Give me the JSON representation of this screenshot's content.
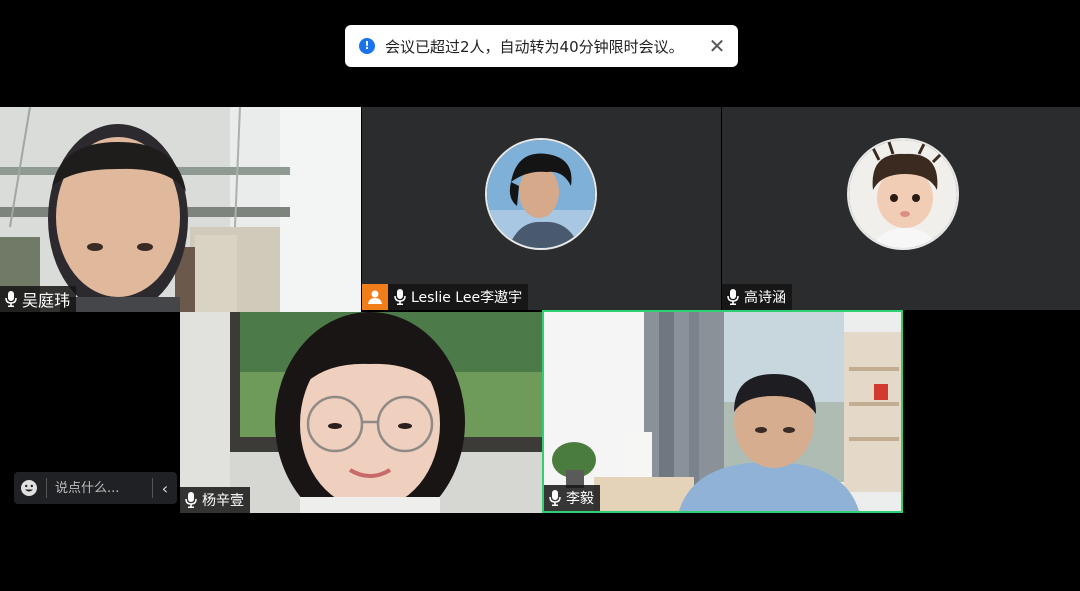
{
  "toast": {
    "icon": "info-icon",
    "icon_glyph": "!",
    "message": "会议已超过2人，自动转为40分钟限时会议。",
    "close_glyph": "✕"
  },
  "participants": [
    {
      "name": "吴庭玮",
      "kind": "video"
    },
    {
      "name": "Leslie Lee李遨宇",
      "kind": "avatar",
      "host": true
    },
    {
      "name": "高诗涵",
      "kind": "avatar"
    },
    {
      "name": "杨辛壹",
      "kind": "video"
    },
    {
      "name": "李毅",
      "kind": "video",
      "active_speaker": true
    }
  ],
  "chat": {
    "placeholder": "说点什么...",
    "collapse_glyph": "‹"
  },
  "colors": {
    "active_speaker_border": "#2fcf73",
    "host_badge": "#f27d1b",
    "toast_icon": "#1a73e8"
  }
}
